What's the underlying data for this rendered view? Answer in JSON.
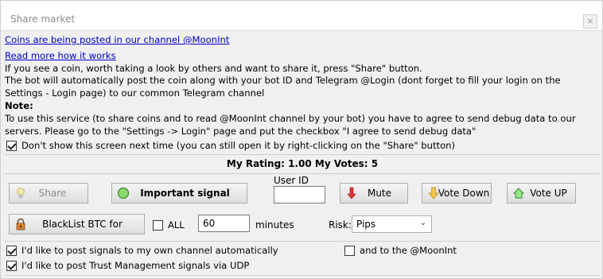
{
  "window": {
    "title": "Share market",
    "close": "×"
  },
  "info": {
    "link_channel": "Coins are being posted in our channel @MoonInt",
    "link_read_more": "Read more how it works",
    "line1": "If you see a coin, worth taking a look by others and want to share it, press \"Share\" button.",
    "line2": "The bot will automatically post the coin along with your bot ID and Telegram @Login (dont forget to fill your login on the Settings - Login page) to our common Telegram channel",
    "note_label": "Note:",
    "note_text": "To use this service (to share coins and to read @MoonInt channel by your bot) you have to agree to send debug data to our servers. Please go to the \"Settings -> Login\" page and put the checkbox \"I agree to send debug data\""
  },
  "dont_show": {
    "label": "Don't show this screen next time (you can still open it by right-clicking on the \"Share\" button)",
    "checked": true
  },
  "rating": {
    "text": "My Rating: 1.00  My Votes: 5"
  },
  "buttons": {
    "share": "Share",
    "important": "Important signal",
    "mute": "Mute",
    "vote_down": "Vote Down",
    "vote_up": "Vote UP",
    "blacklist": "BlackList BTC for"
  },
  "user_id": {
    "label": "User ID",
    "value": ""
  },
  "all": {
    "label": "ALL",
    "checked": false
  },
  "minutes": {
    "value": "60",
    "label": "minutes"
  },
  "risk": {
    "label": "Risk:",
    "selected": "Pips"
  },
  "options": {
    "own_channel": {
      "label": "I'd like to post signals to my own channel automatically",
      "checked": true
    },
    "moonint": {
      "label": "and to the @MoonInt",
      "checked": false
    },
    "udp": {
      "label": "I'd like to post Trust Management signals via UDP",
      "checked": true
    }
  },
  "icons": {
    "share": "lightbulb-icon",
    "important": "green-circle-icon",
    "mute": "red-arrow-down-icon",
    "vote_down": "yellow-arrow-down-icon",
    "vote_up": "green-house-icon",
    "blacklist": "padlock-icon"
  }
}
